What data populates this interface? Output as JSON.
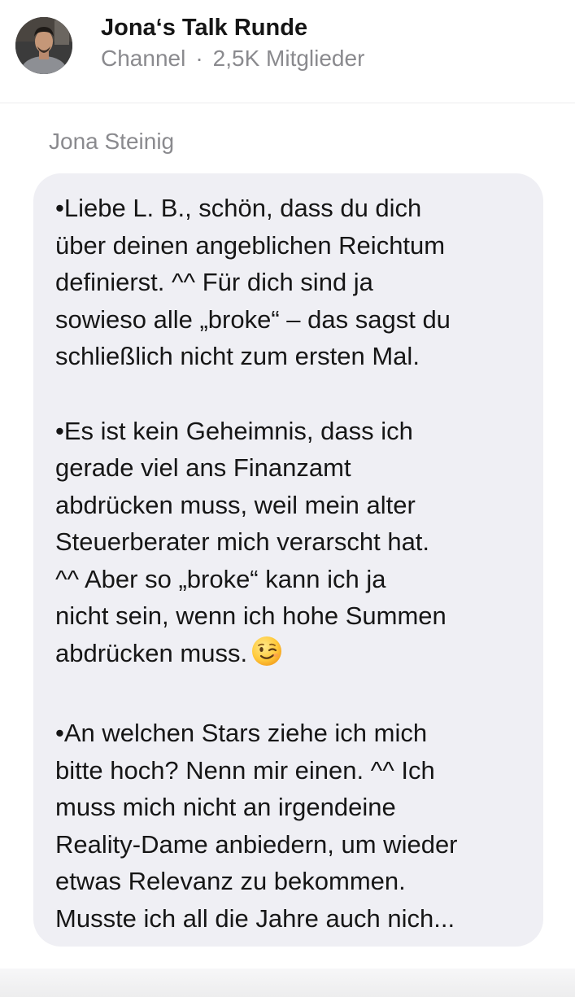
{
  "header": {
    "title": "Jona‘s Talk Runde",
    "type_label": "Channel",
    "separator": "·",
    "member_count": "2,5K Mitglieder"
  },
  "message": {
    "sender": "Jona Steinig",
    "paragraphs": [
      {
        "lines": [
          "•Liebe L. B., schön, dass du dich",
          "über deinen angeblichen Reichtum",
          "definierst. ^^ Für dich sind ja",
          "sowieso alle „broke“ – das sagst du",
          "schließlich nicht zum ersten Mal."
        ]
      },
      {
        "lines": [
          "•Es ist kein Geheimnis, dass ich",
          "gerade viel ans Finanzamt",
          "abdrücken muss, weil mein alter",
          "Steuerberater mich verarscht hat.",
          "^^ Aber so „broke“ kann ich ja",
          "nicht sein, wenn ich hohe Summen",
          "abdrücken muss."
        ],
        "trailing_icon": "winking-face-emoji"
      },
      {
        "lines": [
          "•An welchen Stars ziehe ich mich",
          "bitte hoch? Nenn mir einen. ^^ Ich",
          "muss mich nicht an irgendeine",
          "Reality-Dame anbiedern, um wieder",
          "etwas Relevanz zu bekommen.",
          "Musste ich all die Jahre auch nich..."
        ]
      }
    ]
  },
  "colors": {
    "bubble_background": "#efeff4",
    "secondary_text": "#8a8a8e",
    "primary_text": "#161616"
  }
}
